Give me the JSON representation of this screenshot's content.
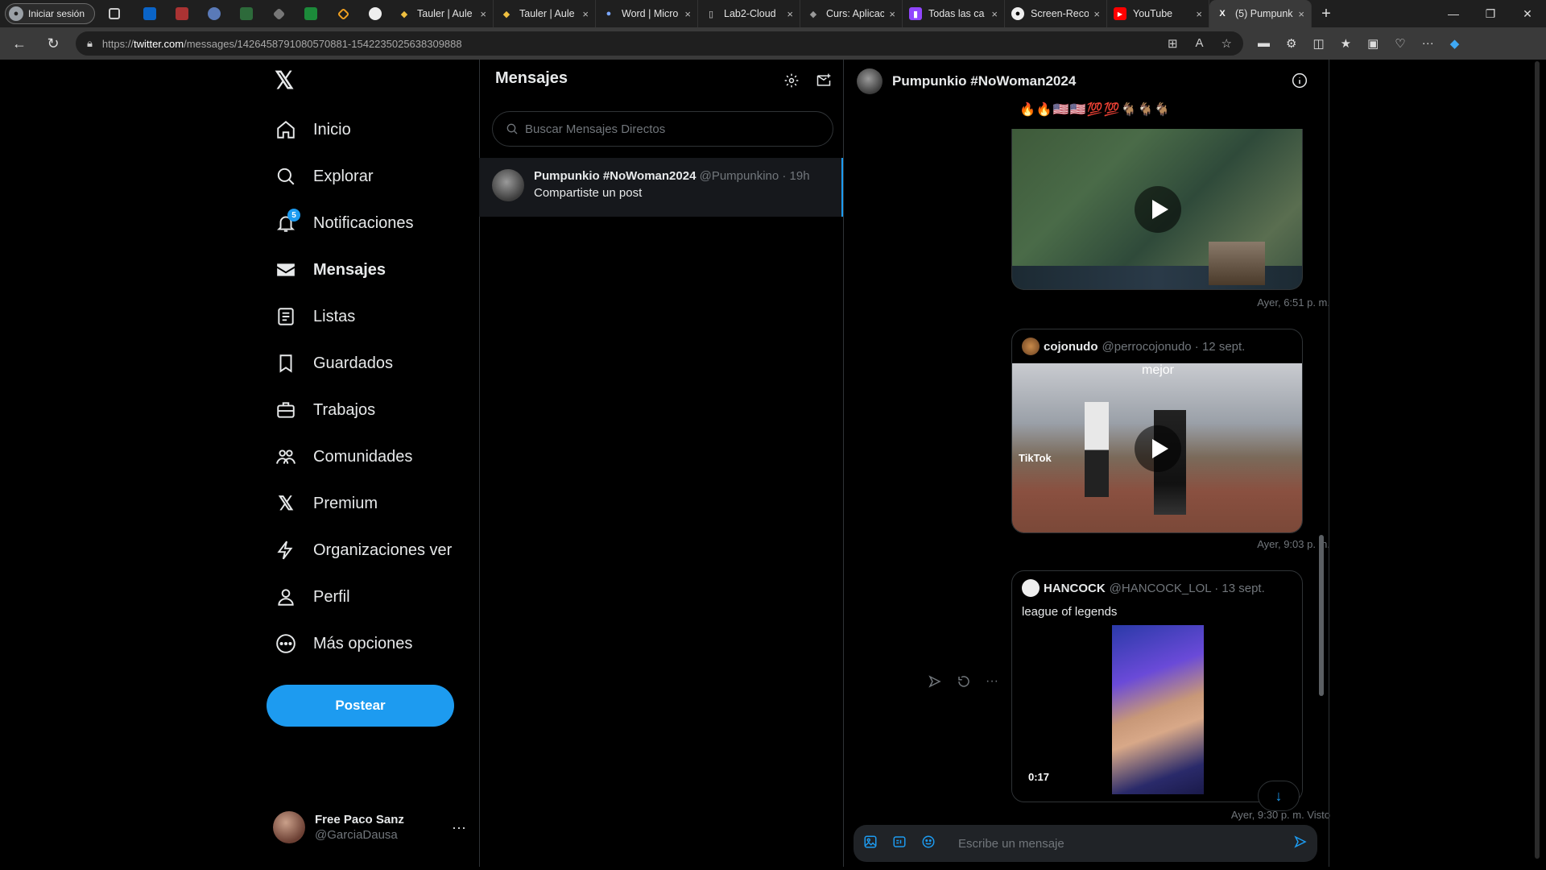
{
  "browser": {
    "profile_label": "Iniciar sesión",
    "tabs": [
      {
        "title": "Tauler | Aule",
        "close": "×"
      },
      {
        "title": "Tauler | Aule",
        "close": "×"
      },
      {
        "title": "Word | Micro",
        "close": "×"
      },
      {
        "title": "Lab2-Cloud",
        "close": "×"
      },
      {
        "title": "Curs: Aplicac",
        "close": "×"
      },
      {
        "title": "Todas las ca",
        "close": "×"
      },
      {
        "title": "Screen-Reco",
        "close": "×"
      },
      {
        "title": "YouTube",
        "close": "×"
      },
      {
        "title": "(5) Pumpunk",
        "close": "×"
      }
    ],
    "url_prefix": "https://",
    "url_host": "twitter.com",
    "url_path": "/messages/1426458791080570881-1542235025638309888"
  },
  "sidebar": {
    "items": [
      {
        "label": "Inicio",
        "icon": "home-icon"
      },
      {
        "label": "Explorar",
        "icon": "search-icon"
      },
      {
        "label": "Notificaciones",
        "icon": "bell-icon",
        "badge": "5"
      },
      {
        "label": "Mensajes",
        "icon": "mail-icon"
      },
      {
        "label": "Listas",
        "icon": "list-icon"
      },
      {
        "label": "Guardados",
        "icon": "bookmark-icon"
      },
      {
        "label": "Trabajos",
        "icon": "briefcase-icon"
      },
      {
        "label": "Comunidades",
        "icon": "people-icon"
      },
      {
        "label": "Premium",
        "icon": "x-icon"
      },
      {
        "label": "Organizaciones ver",
        "icon": "bolt-icon"
      },
      {
        "label": "Perfil",
        "icon": "person-icon"
      },
      {
        "label": "Más opciones",
        "icon": "more-circle-icon"
      }
    ],
    "post_label": "Postear",
    "account": {
      "name": "Free Paco Sanz",
      "handle": "@GarciaDausa",
      "more": "···"
    }
  },
  "messages": {
    "title": "Mensajes",
    "search_placeholder": "Buscar Mensajes Directos",
    "conversation": {
      "name": "Pumpunkio #NoWoman2024",
      "meta": "@Pumpunkino · 19h",
      "preview": "Compartiste un post"
    }
  },
  "chat": {
    "title": "Pumpunkio #NoWoman2024",
    "emojis": "🔥🔥🇺🇸🇺🇸💯💯🐐🐐🐐",
    "ts1": "Ayer, 6:51 p. m.",
    "card2": {
      "author": "cojonudo",
      "meta": "@perrocojonudo · 12 sept.",
      "overlay": "mejor",
      "watermark": "TikTok"
    },
    "ts2": "Ayer, 9:03 p. m.",
    "card3": {
      "author": "HANCOCK",
      "meta": "@HANCOCK_LOL · 13 sept.",
      "text": "league of legends",
      "duration": "0:17"
    },
    "ts3": "Ayer, 9:30 p. m. Visto",
    "composer_placeholder": "Escribe un mensaje"
  },
  "colors": {
    "accent": "#1d9bf0",
    "background": "#000000",
    "border": "#2f3336",
    "muted": "#71767b"
  }
}
